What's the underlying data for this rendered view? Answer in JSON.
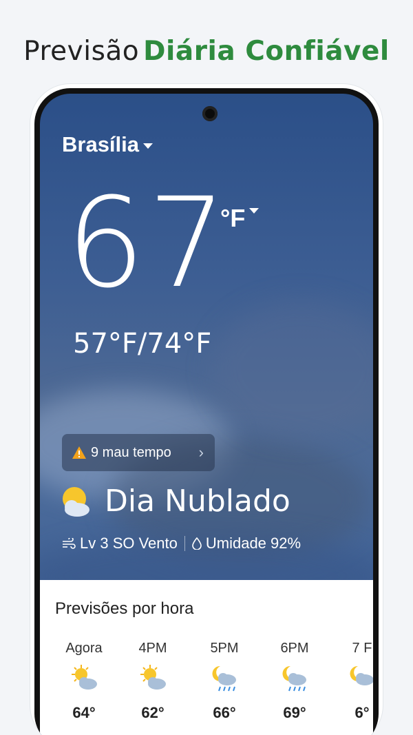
{
  "headline": {
    "prefix": "Previsão",
    "accent": "Diária Confiável"
  },
  "weather": {
    "city": "Brasília",
    "temperature": "67",
    "unit": "°F",
    "range": "57°F/74°F",
    "alert": "9 mau tempo",
    "condition": "Dia Nublado",
    "wind": "Lv 3 SO Vento",
    "humidity": "Umidade 92%"
  },
  "hourly": {
    "title": "Previsões por hora",
    "items": [
      {
        "time": "Agora",
        "icon": "partly-sunny-icon",
        "temp": "64°"
      },
      {
        "time": "4PM",
        "icon": "partly-sunny-icon",
        "temp": "62°"
      },
      {
        "time": "5PM",
        "icon": "night-rain-icon",
        "temp": "66°"
      },
      {
        "time": "6PM",
        "icon": "night-rain-icon",
        "temp": "69°"
      },
      {
        "time": "7 F",
        "icon": "night-rain-icon",
        "temp": "6°"
      }
    ]
  },
  "colors": {
    "accent": "#2e8b3e",
    "sky_top": "#2b4f88",
    "sky_bottom": "#2e568f"
  }
}
